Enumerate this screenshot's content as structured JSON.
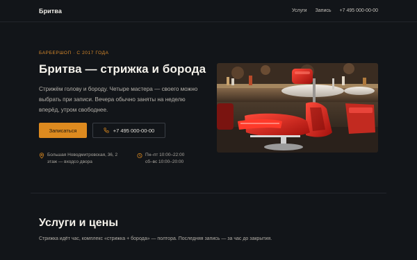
{
  "header": {
    "brand": "Бритва",
    "nav": [
      "Услуги",
      "Запись",
      "+7 495 000-00-00"
    ]
  },
  "hero": {
    "eyebrow": "БАРБЕРШОП · С 2017 ГОДА",
    "title": "Бритва — стрижка и борода",
    "lead": "Стрижём голову и бороду. Четыре мастера — своего можно выбрать при записи. Вечера обычно заняты на неделю вперёд, утром свободнее.",
    "cta_label": "Записаться",
    "phone_label": "+7 495 000-00-00",
    "address_line1": "Большая Новодмитровская, 36, 2",
    "address_line2": "этаж — входсо двора",
    "hours_line1": "Пн–пт 10:00–22:00",
    "hours_line2": "сб–вс 10:00–20:00",
    "image_icon": "barber-chair-photo"
  },
  "services": {
    "title": "Услуги и цены",
    "subtitle": "Стрижка идёт час, комплекс «стрижка + борода» — полтора. Последняя запись — за час до закрытия."
  },
  "colors": {
    "background": "#121519",
    "accent": "#dd8a1f",
    "eyebrow": "#d98a2b"
  }
}
